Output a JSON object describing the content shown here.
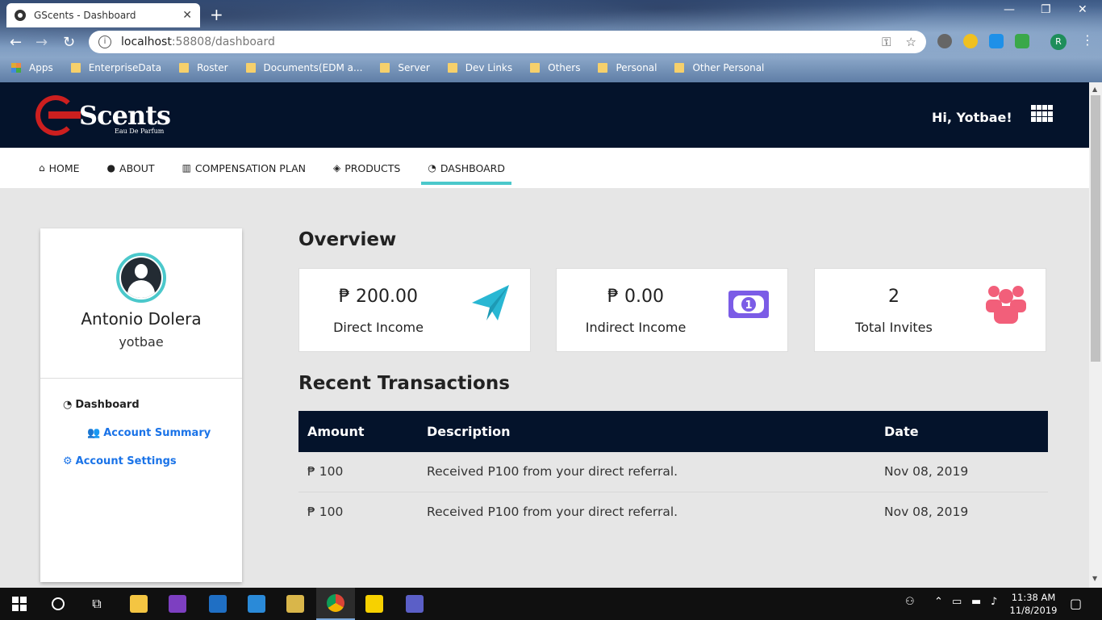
{
  "browser": {
    "tab_title": "GScents - Dashboard",
    "url_host": "localhost",
    "url_path": ":58808/dashboard",
    "profile_initial": "R",
    "bookmarks": [
      "Apps",
      "EnterpriseData",
      "Roster",
      "Documents(EDM a...",
      "Server",
      "Dev Links",
      "Others",
      "Personal",
      "Other Personal"
    ]
  },
  "site": {
    "logo_text": "Scents",
    "logo_subtext": "Eau De Parfum",
    "greeting": "Hi, Yotbae!",
    "nav": [
      {
        "label": "HOME",
        "icon": "home-icon"
      },
      {
        "label": "ABOUT",
        "icon": "globe-icon"
      },
      {
        "label": "COMPENSATION PLAN",
        "icon": "bar-chart-icon"
      },
      {
        "label": "PRODUCTS",
        "icon": "tags-icon"
      },
      {
        "label": "DASHBOARD",
        "icon": "dashboard-icon"
      }
    ]
  },
  "profile": {
    "name": "Antonio Dolera",
    "username": "yotbae"
  },
  "sidebar": {
    "dashboard": "Dashboard",
    "account_summary": "Account Summary",
    "account_settings": "Account Settings"
  },
  "overview": {
    "title": "Overview",
    "cards": [
      {
        "value": "₱ 200.00",
        "label": "Direct Income",
        "icon": "paper-plane-icon",
        "color": "#29b7d3"
      },
      {
        "value": "₱ 0.00",
        "label": "Indirect Income",
        "icon": "money-bill-icon",
        "color": "#7b5ce6"
      },
      {
        "value": "2",
        "label": "Total Invites",
        "icon": "users-icon",
        "color": "#f25f7a"
      }
    ]
  },
  "transactions": {
    "title": "Recent Transactions",
    "headers": [
      "Amount",
      "Description",
      "Date"
    ],
    "rows": [
      [
        "₱ 100",
        "Received P100 from your direct referral.",
        "Nov 08, 2019"
      ],
      [
        "₱ 100",
        "Received P100 from your direct referral.",
        "Nov 08, 2019"
      ]
    ]
  },
  "taskbar": {
    "time": "11:38 AM",
    "date": "11/8/2019"
  },
  "colors": {
    "navy": "#04132b",
    "accent": "#4bc8cb",
    "link": "#1a73e8"
  }
}
